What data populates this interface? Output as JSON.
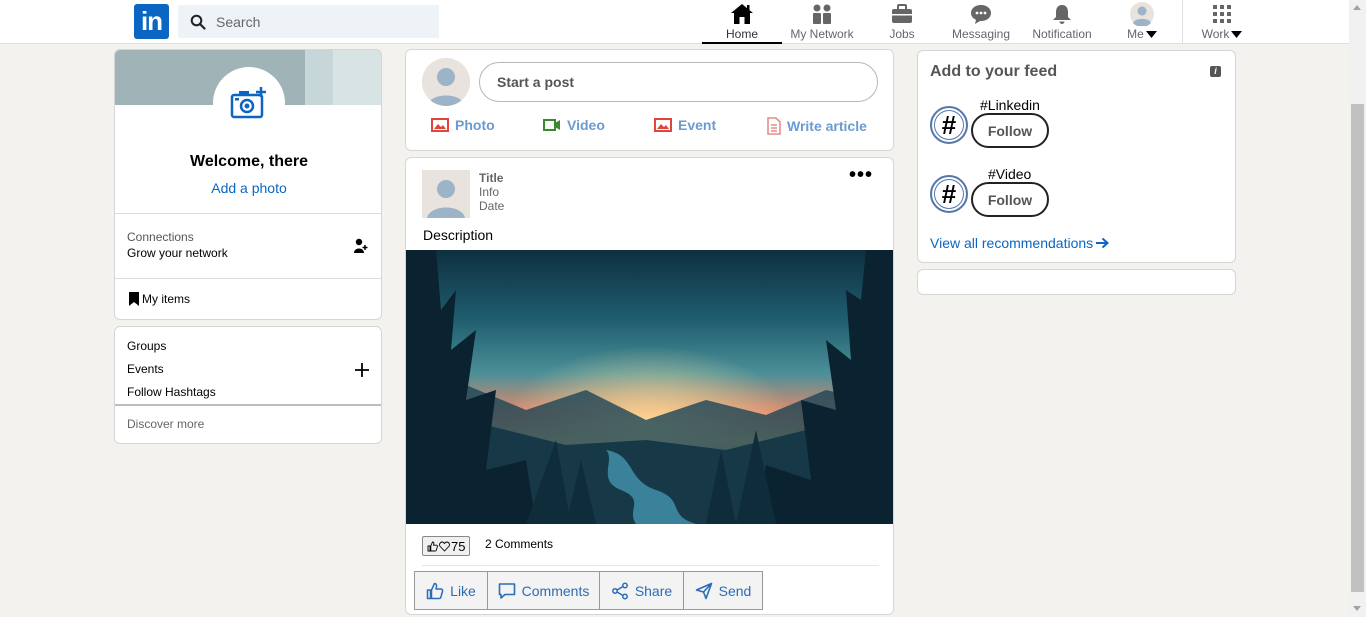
{
  "header": {
    "logo_text": "in",
    "search_placeholder": "Search",
    "nav": [
      {
        "label": "Home",
        "icon": "home-icon"
      },
      {
        "label": "My Network",
        "icon": "network-icon"
      },
      {
        "label": "Jobs",
        "icon": "briefcase-icon"
      },
      {
        "label": "Messaging",
        "icon": "message-icon"
      },
      {
        "label": "Notification",
        "icon": "bell-icon"
      },
      {
        "label": "Me",
        "icon": "avatar-icon"
      },
      {
        "label": "Work",
        "icon": "grid-icon"
      }
    ],
    "active": "Home"
  },
  "profile": {
    "welcome": "Welcome, there",
    "add_photo": "Add a photo",
    "connections_label": "Connections",
    "connections_sub": "Grow your network",
    "my_items": "My items"
  },
  "groups": {
    "items": [
      "Groups",
      "Events",
      "Follow Hashtags"
    ],
    "discover": "Discover more"
  },
  "start_post": {
    "placeholder": "Start a post",
    "actions": [
      {
        "label": "Photo",
        "color": "#e0453b"
      },
      {
        "label": "Video",
        "color": "#3a8a2e"
      },
      {
        "label": "Event",
        "color": "#e0453b"
      },
      {
        "label": "Write article",
        "color": "#e78c8c"
      }
    ]
  },
  "post": {
    "title": "Title",
    "info": "Info",
    "date": "Date",
    "more": "•••",
    "description": "Description",
    "likes_count": "75",
    "comments": "2 Comments",
    "buttons": [
      "Like",
      "Comments",
      "Share",
      "Send"
    ]
  },
  "feed": {
    "title": "Add to your feed",
    "info_glyph": "i",
    "hashtags": [
      {
        "name": "#Linkedin",
        "follow": "Follow"
      },
      {
        "name": "#Video",
        "follow": "Follow"
      }
    ],
    "hash_glyph": "#",
    "view_all": "View all recommendations"
  },
  "colors": {
    "brand": "#0a66c2",
    "background": "#f3f2ef"
  }
}
